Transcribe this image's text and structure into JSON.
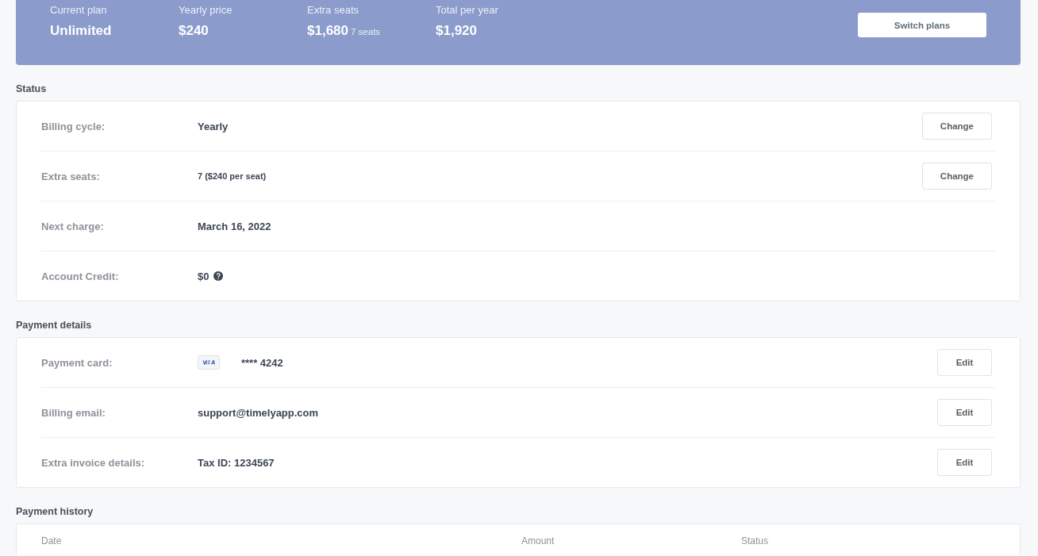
{
  "plan_summary": {
    "items": [
      {
        "label": "Current plan",
        "value": "Unlimited"
      },
      {
        "label": "Yearly price",
        "value": "$240"
      },
      {
        "label": "Extra seats",
        "value": "$1,680",
        "note": "7 seats"
      },
      {
        "label": "Total per year",
        "value": "$1,920"
      }
    ],
    "button": "Switch plans"
  },
  "sections": [
    {
      "title": "Status",
      "rows": [
        {
          "label": "Billing cycle:",
          "kind": "text",
          "value": "Yearly",
          "action": "Change"
        },
        {
          "label": "Extra seats:",
          "kind": "small",
          "value": "7 ($240 per seat)",
          "action": "Change"
        },
        {
          "label": "Next charge:",
          "kind": "text",
          "value": "March 16, 2022"
        },
        {
          "label": "Account Credit:",
          "kind": "help",
          "value": "$0"
        }
      ]
    },
    {
      "title": "Payment details",
      "rows": [
        {
          "label": "Payment card:",
          "kind": "card",
          "value": "**** 4242",
          "action": "Edit"
        },
        {
          "label": "Billing email:",
          "kind": "text",
          "value": "support@timelyapp.com",
          "action": "Edit"
        },
        {
          "label": "Extra invoice details:",
          "kind": "text",
          "value": "Tax ID: 1234567",
          "action": "Edit"
        }
      ]
    }
  ],
  "payment_history": {
    "title": "Payment history",
    "columns": [
      "Date",
      "Amount",
      "Status"
    ]
  }
}
